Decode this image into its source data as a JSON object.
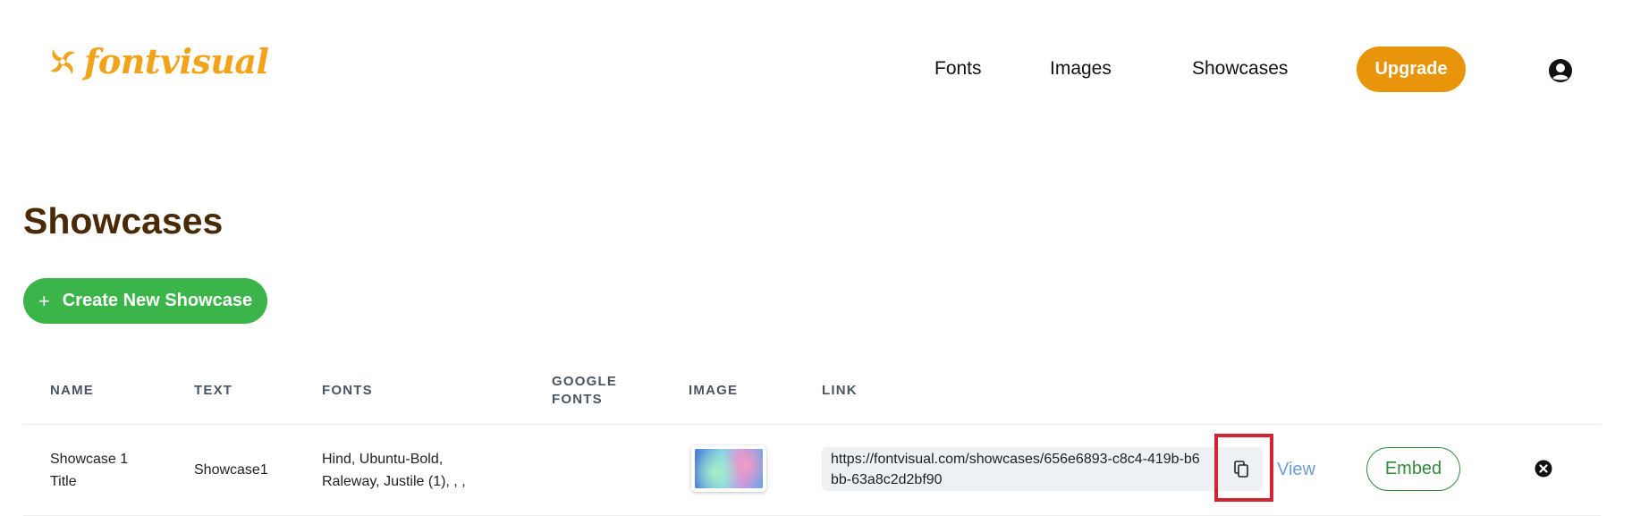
{
  "brand": {
    "name": "fontvisual",
    "color": "#f2a31a"
  },
  "nav": {
    "items": [
      {
        "label": "Fonts"
      },
      {
        "label": "Images"
      },
      {
        "label": "Showcases"
      }
    ],
    "upgrade_label": "Upgrade",
    "user_icon": "user-circle-icon"
  },
  "page": {
    "title": "Showcases",
    "create_label": "Create New Showcase"
  },
  "table": {
    "headers": {
      "name": "NAME",
      "text": "TEXT",
      "fonts": "FONTS",
      "google_fonts_line1": "GOOGLE",
      "google_fonts_line2": "FONTS",
      "image": "IMAGE",
      "link": "LINK"
    },
    "rows": [
      {
        "name_line1": "Showcase 1",
        "name_line2": "Title",
        "text": "Showcase1",
        "fonts_line1": "Hind, Ubuntu-Bold,",
        "fonts_line2": "Raleway, Justile (1), , ,",
        "google_fonts": "",
        "link": "https://fontvisual.com/showcases/656e6893-c8c4-419b-b6bb-63a8c2d2bf90",
        "view_label": "View",
        "embed_label": "Embed"
      }
    ]
  },
  "colors": {
    "upgrade": "#e8950c",
    "create": "#3bb54a",
    "embed": "#2f8b3a",
    "title": "#4a2a06",
    "highlight": "#d42331",
    "view": "#6c9ed3"
  }
}
